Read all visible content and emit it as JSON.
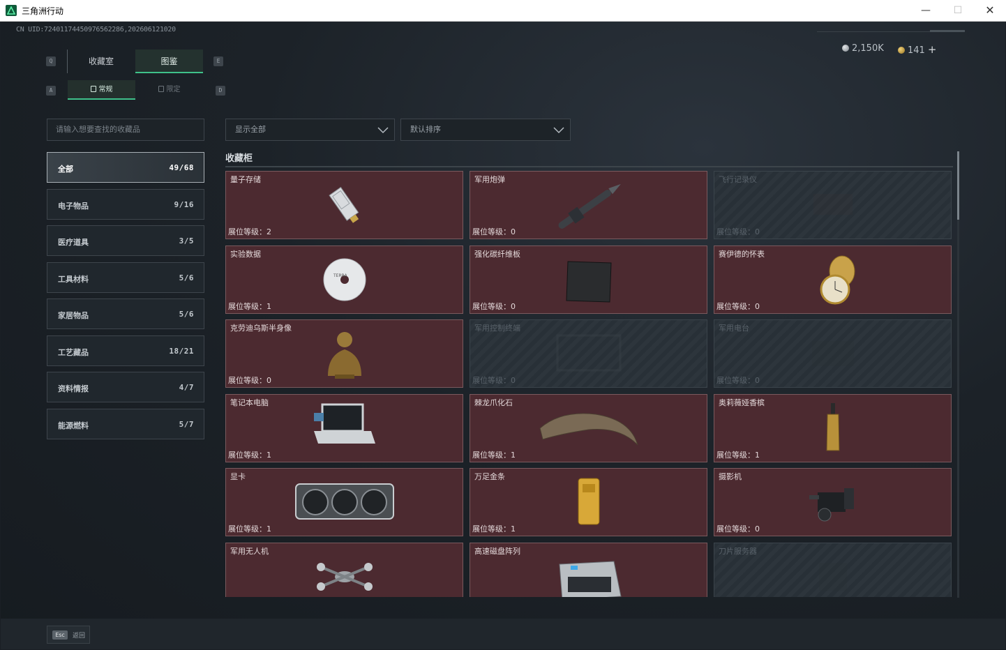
{
  "window": {
    "title": "三角洲行动",
    "min": "—",
    "max": "☐",
    "close": "✕"
  },
  "uid": "CN UID:7240117445097656228​6,2026061210​20",
  "currency": {
    "silver": "2,150K",
    "gold": "141",
    "plus": "+"
  },
  "keys": {
    "top_left": "Q",
    "top_right": "E",
    "sub_left": "A",
    "sub_right": "D"
  },
  "tabs": [
    {
      "label": "收藏室"
    },
    {
      "label": "图鉴",
      "active": true
    }
  ],
  "subtabs": [
    {
      "label": "常规",
      "active": true
    },
    {
      "label": "限定"
    }
  ],
  "search": {
    "placeholder": "请输入想要查找的收藏品"
  },
  "filters": {
    "show": "显示全部",
    "sort": "默认排序"
  },
  "categories": [
    {
      "label": "全部",
      "count": "49/68",
      "active": true
    },
    {
      "label": "电子物品",
      "count": "9/16"
    },
    {
      "label": "医疗道具",
      "count": "3/5"
    },
    {
      "label": "工具材料",
      "count": "5/6"
    },
    {
      "label": "家居物品",
      "count": "5/6"
    },
    {
      "label": "工艺藏品",
      "count": "18/21"
    },
    {
      "label": "资料情报",
      "count": "4/7"
    },
    {
      "label": "能源燃料",
      "count": "5/7"
    }
  ],
  "section": {
    "title": "收藏柜"
  },
  "level_prefix": "展位等级：",
  "items": [
    {
      "name": "量子存储",
      "level": "2",
      "unlocked": true,
      "icon": "quantum-storage-icon"
    },
    {
      "name": "军用炮弹",
      "level": "0",
      "unlocked": true,
      "icon": "shell-icon"
    },
    {
      "name": "飞行记录仪",
      "level": "0",
      "unlocked": false,
      "icon": "flight-recorder-icon"
    },
    {
      "name": "实验数据",
      "level": "1",
      "unlocked": true,
      "icon": "disc-icon"
    },
    {
      "name": "强化碳纤维板",
      "level": "0",
      "unlocked": true,
      "icon": "carbon-plate-icon"
    },
    {
      "name": "赛伊德的怀表",
      "level": "0",
      "unlocked": true,
      "icon": "pocket-watch-icon"
    },
    {
      "name": "克劳迪乌斯半身像",
      "level": "0",
      "unlocked": true,
      "icon": "bust-icon"
    },
    {
      "name": "军用控制终端",
      "level": "0",
      "unlocked": false,
      "icon": "terminal-icon"
    },
    {
      "name": "军用电台",
      "level": "0",
      "unlocked": false,
      "icon": "radio-icon"
    },
    {
      "name": "笔记本电脑",
      "level": "1",
      "unlocked": true,
      "icon": "laptop-icon"
    },
    {
      "name": "棘龙爪化石",
      "level": "1",
      "unlocked": true,
      "icon": "claw-fossil-icon"
    },
    {
      "name": "奥莉薇娅香槟",
      "level": "1",
      "unlocked": true,
      "icon": "champagne-icon"
    },
    {
      "name": "显卡",
      "level": "1",
      "unlocked": true,
      "icon": "gpu-icon"
    },
    {
      "name": "万足金条",
      "level": "1",
      "unlocked": true,
      "icon": "gold-bar-icon"
    },
    {
      "name": "摄影机",
      "level": "0",
      "unlocked": true,
      "icon": "camera-icon"
    },
    {
      "name": "军用无人机",
      "level": "",
      "unlocked": true,
      "icon": "drone-icon"
    },
    {
      "name": "高速磁盘阵列",
      "level": "",
      "unlocked": true,
      "icon": "disk-array-icon"
    },
    {
      "name": "刀片服务器",
      "level": "",
      "unlocked": false,
      "icon": "blade-server-icon"
    }
  ],
  "footer": {
    "key": "Esc",
    "label": "返回"
  }
}
